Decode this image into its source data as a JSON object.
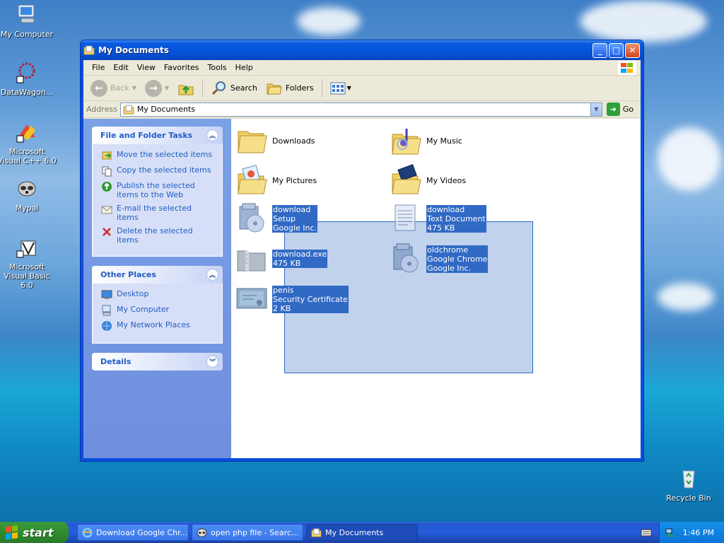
{
  "desktop": {
    "icons": [
      {
        "label": "My Computer"
      },
      {
        "label": "DataWagon..."
      },
      {
        "label": "Microsoft Visual C++ 6.0"
      },
      {
        "label": "Mypal"
      },
      {
        "label": "Microsoft Visual Basic 6.0"
      },
      {
        "label": "Recycle Bin"
      }
    ]
  },
  "window": {
    "title": "My Documents",
    "menu": [
      "File",
      "Edit",
      "View",
      "Favorites",
      "Tools",
      "Help"
    ],
    "toolbar": {
      "back": "Back",
      "search": "Search",
      "folders": "Folders"
    },
    "address": {
      "label": "Address",
      "value": "My Documents",
      "go": "Go"
    },
    "tasks": {
      "file_folder": {
        "title": "File and Folder Tasks",
        "items": [
          "Move the selected items",
          "Copy the selected items",
          "Publish the selected items to the Web",
          "E-mail the selected items",
          "Delete the selected items"
        ]
      },
      "other_places": {
        "title": "Other Places",
        "items": [
          "Desktop",
          "My Computer",
          "My Network Places"
        ]
      },
      "details": {
        "title": "Details"
      }
    },
    "items": [
      {
        "name": "Downloads"
      },
      {
        "name": "My Music"
      },
      {
        "name": "My Pictures"
      },
      {
        "name": "My Videos"
      },
      {
        "l1": "download",
        "l2": "Setup",
        "l3": "Google Inc."
      },
      {
        "l1": "download",
        "l2": "Text Document",
        "l3": "475 KB"
      },
      {
        "l1": "download.exe",
        "l2": "475 KB"
      },
      {
        "l1": "oldchrome",
        "l2": "Google Chrome",
        "l3": "Google Inc."
      },
      {
        "l1": "penis",
        "l2": "Security Certificate",
        "l3": "2 KB"
      }
    ]
  },
  "taskbar": {
    "start": "start",
    "tasks": [
      "Download Google Chr...",
      "open php file - Searc...",
      "My Documents"
    ],
    "clock": "1:46 PM"
  },
  "colors": {
    "link": "#215dc6",
    "selection": "#316ac5",
    "titlebar": "#0553d9"
  }
}
